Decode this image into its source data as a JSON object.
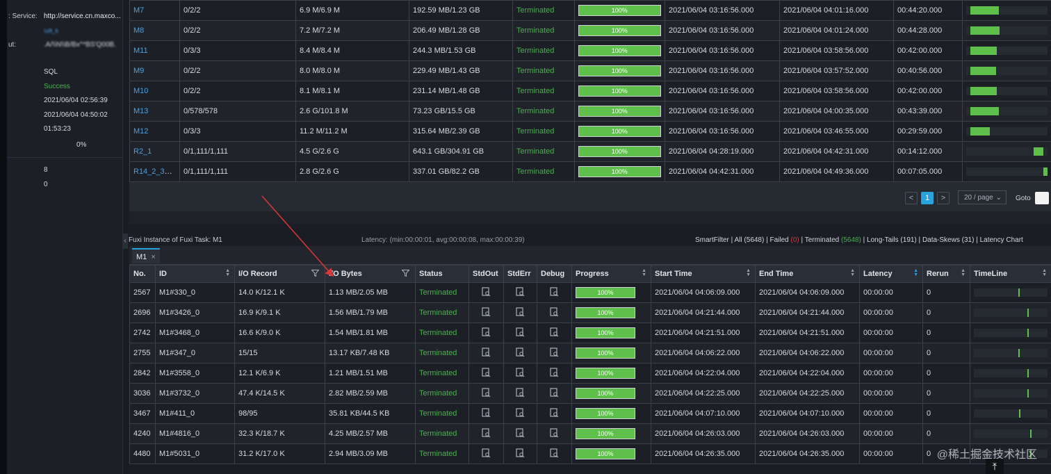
{
  "job_info": {
    "service_label": ": Service:",
    "service_value": "http://service.cn.maxco...",
    "link_blurred": "\\ulll_b",
    "field_label": "ut:",
    "field_value_blurred": ".A/\\\\N\\\\B/Bx^*BS'Q00B.",
    "type": "SQL",
    "status": "Success",
    "start_time": "2021/06/04 02:56:39",
    "end_time": "2021/06/04 04:50:02",
    "duration": "01:53:23",
    "progress": "0%",
    "count_a": "8",
    "count_b": "0"
  },
  "task_table": {
    "rows": [
      {
        "name": "M7",
        "instances": "0/2/2",
        "records": "6.9 M/6.9 M",
        "bytes": "192.59 MB/1.23 GB",
        "status": "Terminated",
        "progress": "100%",
        "start": "2021/06/04 03:16:56.000",
        "end": "2021/06/04 04:01:16.000",
        "latency": "00:44:20.000",
        "timeline_start": 0.05,
        "timeline_end": 0.4
      },
      {
        "name": "M8",
        "instances": "0/2/2",
        "records": "7.2 M/7.2 M",
        "bytes": "206.49 MB/1.28 GB",
        "status": "Terminated",
        "progress": "100%",
        "start": "2021/06/04 03:16:56.000",
        "end": "2021/06/04 04:01:24.000",
        "latency": "00:44:28.000",
        "timeline_start": 0.05,
        "timeline_end": 0.41
      },
      {
        "name": "M11",
        "instances": "0/3/3",
        "records": "8.4 M/8.4 M",
        "bytes": "244.3 MB/1.53 GB",
        "status": "Terminated",
        "progress": "100%",
        "start": "2021/06/04 03:16:56.000",
        "end": "2021/06/04 03:58:56.000",
        "latency": "00:42:00.000",
        "timeline_start": 0.05,
        "timeline_end": 0.38
      },
      {
        "name": "M9",
        "instances": "0/2/2",
        "records": "8.0 M/8.0 M",
        "bytes": "229.49 MB/1.43 GB",
        "status": "Terminated",
        "progress": "100%",
        "start": "2021/06/04 03:16:56.000",
        "end": "2021/06/04 03:57:52.000",
        "latency": "00:40:56.000",
        "timeline_start": 0.05,
        "timeline_end": 0.37
      },
      {
        "name": "M10",
        "instances": "0/2/2",
        "records": "8.1 M/8.1 M",
        "bytes": "231.14 MB/1.48 GB",
        "status": "Terminated",
        "progress": "100%",
        "start": "2021/06/04 03:16:56.000",
        "end": "2021/06/04 03:58:56.000",
        "latency": "00:42:00.000",
        "timeline_start": 0.05,
        "timeline_end": 0.38
      },
      {
        "name": "M13",
        "instances": "0/578/578",
        "records": "2.6 G/101.8 M",
        "bytes": "73.23 GB/15.5 GB",
        "status": "Terminated",
        "progress": "100%",
        "start": "2021/06/04 03:16:56.000",
        "end": "2021/06/04 04:00:35.000",
        "latency": "00:43:39.000",
        "timeline_start": 0.05,
        "timeline_end": 0.4
      },
      {
        "name": "M12",
        "instances": "0/3/3",
        "records": "11.2 M/11.2 M",
        "bytes": "315.64 MB/2.39 GB",
        "status": "Terminated",
        "progress": "100%",
        "start": "2021/06/04 03:16:56.000",
        "end": "2021/06/04 03:46:55.000",
        "latency": "00:29:59.000",
        "timeline_start": 0.05,
        "timeline_end": 0.29
      },
      {
        "name": "R2_1",
        "instances": "0/1,111/1,111",
        "records": "4.5 G/2.6 G",
        "bytes": "643.1 GB/304.91 GB",
        "status": "Terminated",
        "progress": "100%",
        "start": "2021/06/04 04:28:19.000",
        "end": "2021/06/04 04:42:31.000",
        "latency": "00:14:12.000",
        "timeline_start": 0.83,
        "timeline_end": 0.95
      },
      {
        "name": "R14_2_3_4_...",
        "instances": "0/1,111/1,111",
        "records": "2.8 G/2.6 G",
        "bytes": "337.01 GB/82.2 GB",
        "status": "Terminated",
        "progress": "100%",
        "start": "2021/06/04 04:42:31.000",
        "end": "2021/06/04 04:49:36.000",
        "latency": "00:07:05.000",
        "timeline_start": 0.95,
        "timeline_end": 1.0
      }
    ]
  },
  "pagination": {
    "prev": "<",
    "current": "1",
    "next": ">",
    "page_size": "20 / page",
    "goto": "Goto"
  },
  "instance_panel": {
    "title": "Fuxi Instance of Fuxi Task: M1",
    "latency_summary": "Latency: (min:00:00:01, avg:00:00:08, max:00:00:39)",
    "smart_filter": "SmartFilter",
    "filter_all": "All",
    "filter_all_count": "(5648)",
    "filter_failed": "Failed",
    "filter_failed_count": "(0)",
    "filter_terminated": "Terminated",
    "filter_terminated_count": "(5648)",
    "filter_longtails": "Long-Tails",
    "filter_longtails_count": "(191)",
    "filter_dataskews": "Data-Skews",
    "filter_dataskews_count": "(31)",
    "latency_chart": "Latency Chart",
    "tab_label": "M1",
    "tab_close": "×",
    "columns": [
      "No.",
      "ID",
      "I/O Record",
      "I/O Bytes",
      "Status",
      "StdOut",
      "StdErr",
      "Debug",
      "Progress",
      "Start Time",
      "End Time",
      "Latency",
      "Rerun",
      "TimeLine"
    ],
    "rows": [
      {
        "no": "2567",
        "id": "M1#330_0",
        "record": "14.0 K/12.1 K",
        "bytes": "1.13 MB/2.05 MB",
        "status": "Terminated",
        "progress": "100%",
        "start": "2021/06/04 04:06:09.000",
        "end": "2021/06/04 04:06:09.000",
        "latency": "00:00:00",
        "rerun": "0",
        "tick": 0.6
      },
      {
        "no": "2696",
        "id": "M1#3426_0",
        "record": "16.9 K/9.1 K",
        "bytes": "1.56 MB/1.79 MB",
        "status": "Terminated",
        "progress": "100%",
        "start": "2021/06/04 04:21:44.000",
        "end": "2021/06/04 04:21:44.000",
        "latency": "00:00:00",
        "rerun": "0",
        "tick": 0.73
      },
      {
        "no": "2742",
        "id": "M1#3468_0",
        "record": "16.6 K/9.0 K",
        "bytes": "1.54 MB/1.81 MB",
        "status": "Terminated",
        "progress": "100%",
        "start": "2021/06/04 04:21:51.000",
        "end": "2021/06/04 04:21:51.000",
        "latency": "00:00:00",
        "rerun": "0",
        "tick": 0.73
      },
      {
        "no": "2755",
        "id": "M1#347_0",
        "record": "15/15",
        "bytes": "13.17 KB/7.48 KB",
        "status": "Terminated",
        "progress": "100%",
        "start": "2021/06/04 04:06:22.000",
        "end": "2021/06/04 04:06:22.000",
        "latency": "00:00:00",
        "rerun": "0",
        "tick": 0.6
      },
      {
        "no": "2842",
        "id": "M1#3558_0",
        "record": "12.1 K/6.9 K",
        "bytes": "1.21 MB/1.51 MB",
        "status": "Terminated",
        "progress": "100%",
        "start": "2021/06/04 04:22:04.000",
        "end": "2021/06/04 04:22:04.000",
        "latency": "00:00:00",
        "rerun": "0",
        "tick": 0.73
      },
      {
        "no": "3036",
        "id": "M1#3732_0",
        "record": "47.4 K/14.5 K",
        "bytes": "2.82 MB/2.59 MB",
        "status": "Terminated",
        "progress": "100%",
        "start": "2021/06/04 04:22:25.000",
        "end": "2021/06/04 04:22:25.000",
        "latency": "00:00:00",
        "rerun": "0",
        "tick": 0.73
      },
      {
        "no": "3467",
        "id": "M1#411_0",
        "record": "98/95",
        "bytes": "35.81 KB/44.5 KB",
        "status": "Terminated",
        "progress": "100%",
        "start": "2021/06/04 04:07:10.000",
        "end": "2021/06/04 04:07:10.000",
        "latency": "00:00:00",
        "rerun": "0",
        "tick": 0.61
      },
      {
        "no": "4240",
        "id": "M1#4816_0",
        "record": "32.3 K/18.7 K",
        "bytes": "4.25 MB/2.57 MB",
        "status": "Terminated",
        "progress": "100%",
        "start": "2021/06/04 04:26:03.000",
        "end": "2021/06/04 04:26:03.000",
        "latency": "00:00:00",
        "rerun": "0",
        "tick": 0.76
      },
      {
        "no": "4480",
        "id": "M1#5031_0",
        "record": "31.2 K/17.0 K",
        "bytes": "2.94 MB/3.09 MB",
        "status": "Terminated",
        "progress": "100%",
        "start": "2021/06/04 04:26:35.000",
        "end": "2021/06/04 04:26:35.000",
        "latency": "00:00:00",
        "rerun": "0",
        "tick": 0.76
      }
    ]
  },
  "watermark": "@稀土掘金技术社区",
  "scroll_top_icon": "arrow-up-to-top-icon",
  "colors": {
    "accent": "#27a3e0",
    "success": "#5ec04a",
    "terminated": "#4caf50",
    "link": "#4ea1de",
    "annotation_arrow": "#d9383a"
  }
}
